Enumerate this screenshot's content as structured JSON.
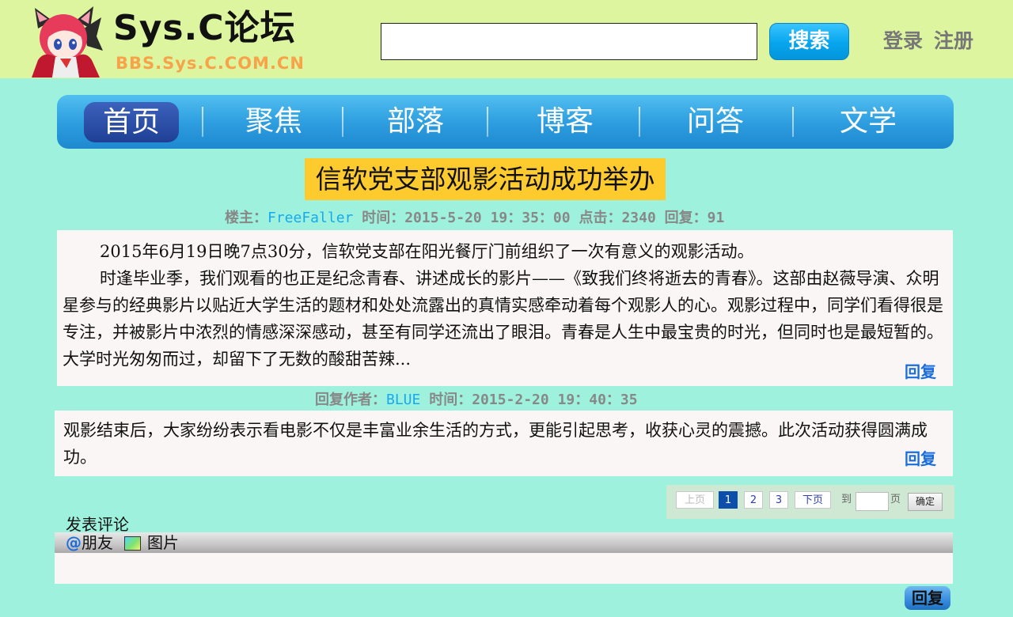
{
  "header": {
    "logo_title": "Sys.C论坛",
    "logo_subtitle": "BBS.Sys.C.COM.CN",
    "search_value": "",
    "search_button": "搜索",
    "login": "登录",
    "register": "注册"
  },
  "nav": {
    "items": [
      "首页",
      "聚焦",
      "部落",
      "博客",
      "问答",
      "文学"
    ],
    "active": "首页"
  },
  "post": {
    "title": "信软党支部观影活动成功举办",
    "meta_owner_label": "楼主：",
    "owner": "FreeFaller",
    "meta_rest": "时间：2015-5-20 19：35：00 点击：2340 回复：91",
    "para1": "2015年6月19日晚7点30分，信软党支部在阳光餐厅门前组织了一次有意义的观影活动。",
    "para2": "时逢毕业季，我们观看的也正是纪念青春、讲述成长的影片——《致我们终将逝去的青春》。这部由赵薇导演、众明星参与的经典影片以贴近大学生活的题材和处处流露出的真情实感牵动着每个观影人的心。观影过程中，同学们看得很是专注，并被影片中浓烈的情感深深感动，甚至有同学还流出了眼泪。青春是人生中最宝贵的时光，但同时也是最短暂的。大学时光匆匆而过，却留下了无数的酸甜苦辣...",
    "reply_link": "回复"
  },
  "reply": {
    "author_label": "回复作者：",
    "author": "BLUE",
    "time": "时间：2015-2-20 19：40：35",
    "text": "观影结束后，大家纷纷表示看电影不仅是丰富业余生活的方式，更能引起思考，收获心灵的震撼。此次活动获得圆满成功。",
    "reply_link": "回复"
  },
  "pagination": {
    "prev": "上页",
    "pages": [
      "1",
      "2",
      "3"
    ],
    "current": "1",
    "next": "下页",
    "goto_label": "到",
    "page_unit": "页",
    "goto_value": "",
    "confirm": "确定"
  },
  "comment": {
    "title": "发表评论",
    "at_symbol": "@",
    "friends": "朋友",
    "image": "图片",
    "text_value": "",
    "submit": "回复"
  },
  "colors": {
    "background": "#9ef2dd",
    "header_bg": "#def59f",
    "title_bg": "#fecb2f",
    "link_blue": "#1a6ddb",
    "username_blue": "#19a8ee"
  },
  "icons": [
    "logo-catgirl-icon",
    "image-icon",
    "at-icon"
  ]
}
